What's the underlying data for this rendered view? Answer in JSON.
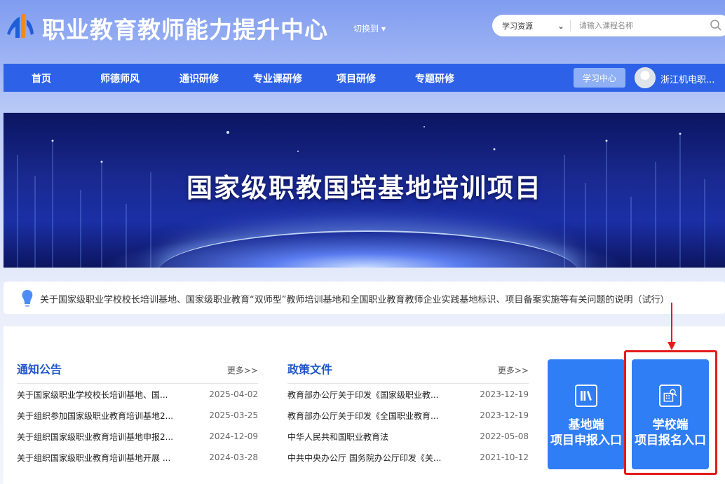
{
  "header": {
    "site_title": "职业教育教师能力提升中心",
    "switch_label": "切换到",
    "search": {
      "category": "学习资源",
      "placeholder": "请输入课程名称"
    }
  },
  "nav": {
    "items": [
      "首页",
      "师德师风",
      "通识研修",
      "专业课研修",
      "项目研修",
      "专题研修"
    ],
    "learn_center": "学习中心",
    "username": "浙江机电职..."
  },
  "banner": {
    "title": "国家级职教国培基地培训项目"
  },
  "notice": {
    "text": "关于国家级职业学校校长培训基地、国家级职业教育“双师型”教师培训基地和全国职业教育教师企业实践基地标识、项目备案实施等有关问题的说明（试行）"
  },
  "announcements": {
    "title": "通知公告",
    "more": "更多>>",
    "rows": [
      {
        "title": "关于国家级职业学校校长培训基地、国...",
        "date": "2025-04-02"
      },
      {
        "title": "关于组织参加国家级职业教育培训基地2...",
        "date": "2025-03-25"
      },
      {
        "title": "关于组织国家级职业教育培训基地申报2...",
        "date": "2024-12-09"
      },
      {
        "title": "关于组织国家级职业教育培训基地开展 ...",
        "date": "2024-03-28"
      }
    ]
  },
  "policies": {
    "title": "政策文件",
    "more": "更多>>",
    "rows": [
      {
        "title": "教育部办公厅关于印发《国家级职业教...",
        "date": "2023-12-19"
      },
      {
        "title": "教育部办公厅关于印发《全国职业教育...",
        "date": "2023-12-19"
      },
      {
        "title": "中华人民共和国职业教育法",
        "date": "2022-05-08"
      },
      {
        "title": "中共中央办公厅 国务院办公厅印发《关...",
        "date": "2021-10-12"
      }
    ]
  },
  "entries": {
    "base": {
      "line1": "基地端",
      "line2": "项目申报入口"
    },
    "school": {
      "line1": "学校端",
      "line2": "项目报名入口"
    }
  },
  "colors": {
    "nav": "#2d62e8",
    "entry": "#2f7ef5",
    "highlight": "#e31b1b",
    "section_title": "#1f56c8"
  }
}
